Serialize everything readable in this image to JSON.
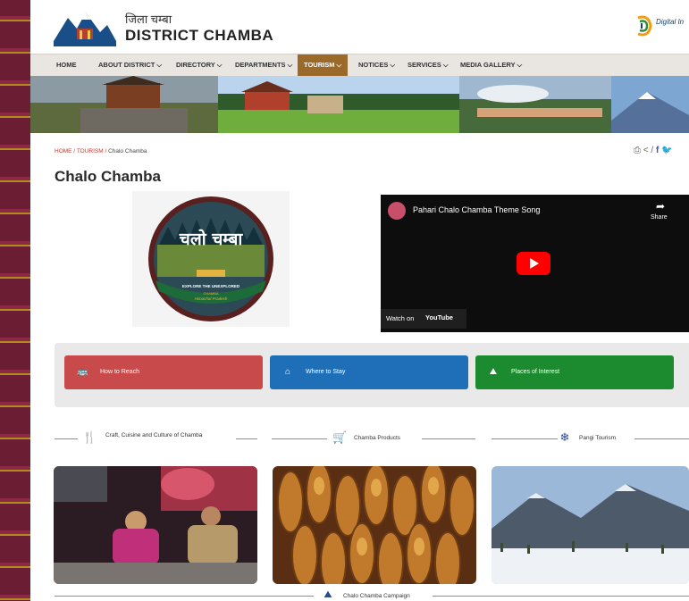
{
  "header": {
    "title_hindi": "जिला चम्बा",
    "title": "DISTRICT CHAMBA",
    "digital_india_label": "Digital In"
  },
  "nav": {
    "items": [
      {
        "label": "HOME"
      },
      {
        "label": "ABOUT DISTRICT ⌵"
      },
      {
        "label": "DIRECTORY ⌵"
      },
      {
        "label": "DEPARTMENTS ⌵"
      },
      {
        "label": "TOURISM ⌵",
        "active": true
      },
      {
        "label": "NOTICES ⌵"
      },
      {
        "label": "SERVICES ⌵"
      },
      {
        "label": "MEDIA GALLERY ⌵"
      }
    ]
  },
  "breadcrumb": {
    "home": "HOME",
    "sep1": " / ",
    "tourism": "TOURISM",
    "sep2": " / ",
    "current": "Chalo Chamba"
  },
  "share": {
    "print": "⎙",
    "share": "<",
    "sep": "/",
    "facebook": "f",
    "twitter": "🐦"
  },
  "page": {
    "title": "Chalo Chamba"
  },
  "logo": {
    "text": "चलो चम्बा",
    "tagline": "EXPLORE THE UNEXPLORED",
    "sub": "Himachal Pradesh",
    "district": "CHAMBA"
  },
  "video": {
    "title": "Pahari Chalo Chamba Theme Song",
    "share_label": "Share",
    "watch_on": "Watch on",
    "youtube": "YouTube"
  },
  "quick_links": [
    {
      "label": "How to Reach",
      "icon": "bus-icon",
      "color": "#c94a4a"
    },
    {
      "label": "Where to Stay",
      "icon": "home-icon",
      "color": "#1f6fb8"
    },
    {
      "label": "Places of Interest",
      "icon": "mountain-icon",
      "color": "#1c8a2e"
    }
  ],
  "sections": [
    {
      "label": "Craft, Cuisine and Culture of Chamba",
      "icon": "utensils-icon"
    },
    {
      "label": "Chamba Products",
      "icon": "cart-icon"
    },
    {
      "label": "Pangi Tourism",
      "icon": "snowflake-icon"
    }
  ],
  "campaign": {
    "label": "Chalo Chamba Campaign"
  },
  "colors": {
    "accent_nav": "#9b6a2a",
    "red": "#c94a4a",
    "blue": "#1f6fb8",
    "green": "#1c8a2e",
    "border_frame": "#5a1b2a"
  }
}
